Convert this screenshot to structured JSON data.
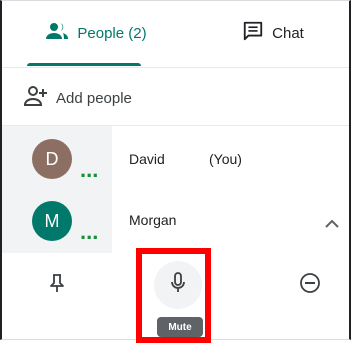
{
  "tabs": {
    "people_label": "People (2)",
    "chat_label": "Chat",
    "accent_color": "#00796b"
  },
  "add_people": {
    "label": "Add people",
    "icon": "add-person-icon"
  },
  "participants": [
    {
      "initial": "D",
      "name": "David",
      "suffix": "(You)",
      "avatar_color": "#8d6e63"
    },
    {
      "initial": "M",
      "name": "Morgan",
      "suffix": "",
      "avatar_color": "#00796b"
    }
  ],
  "activity_indicator": "...",
  "actions": {
    "pin_icon": "pin-icon",
    "mute_icon": "microphone-icon",
    "remove_icon": "minus-circle-icon",
    "mute_tooltip": "Mute"
  },
  "highlight_color": "#ff0000"
}
